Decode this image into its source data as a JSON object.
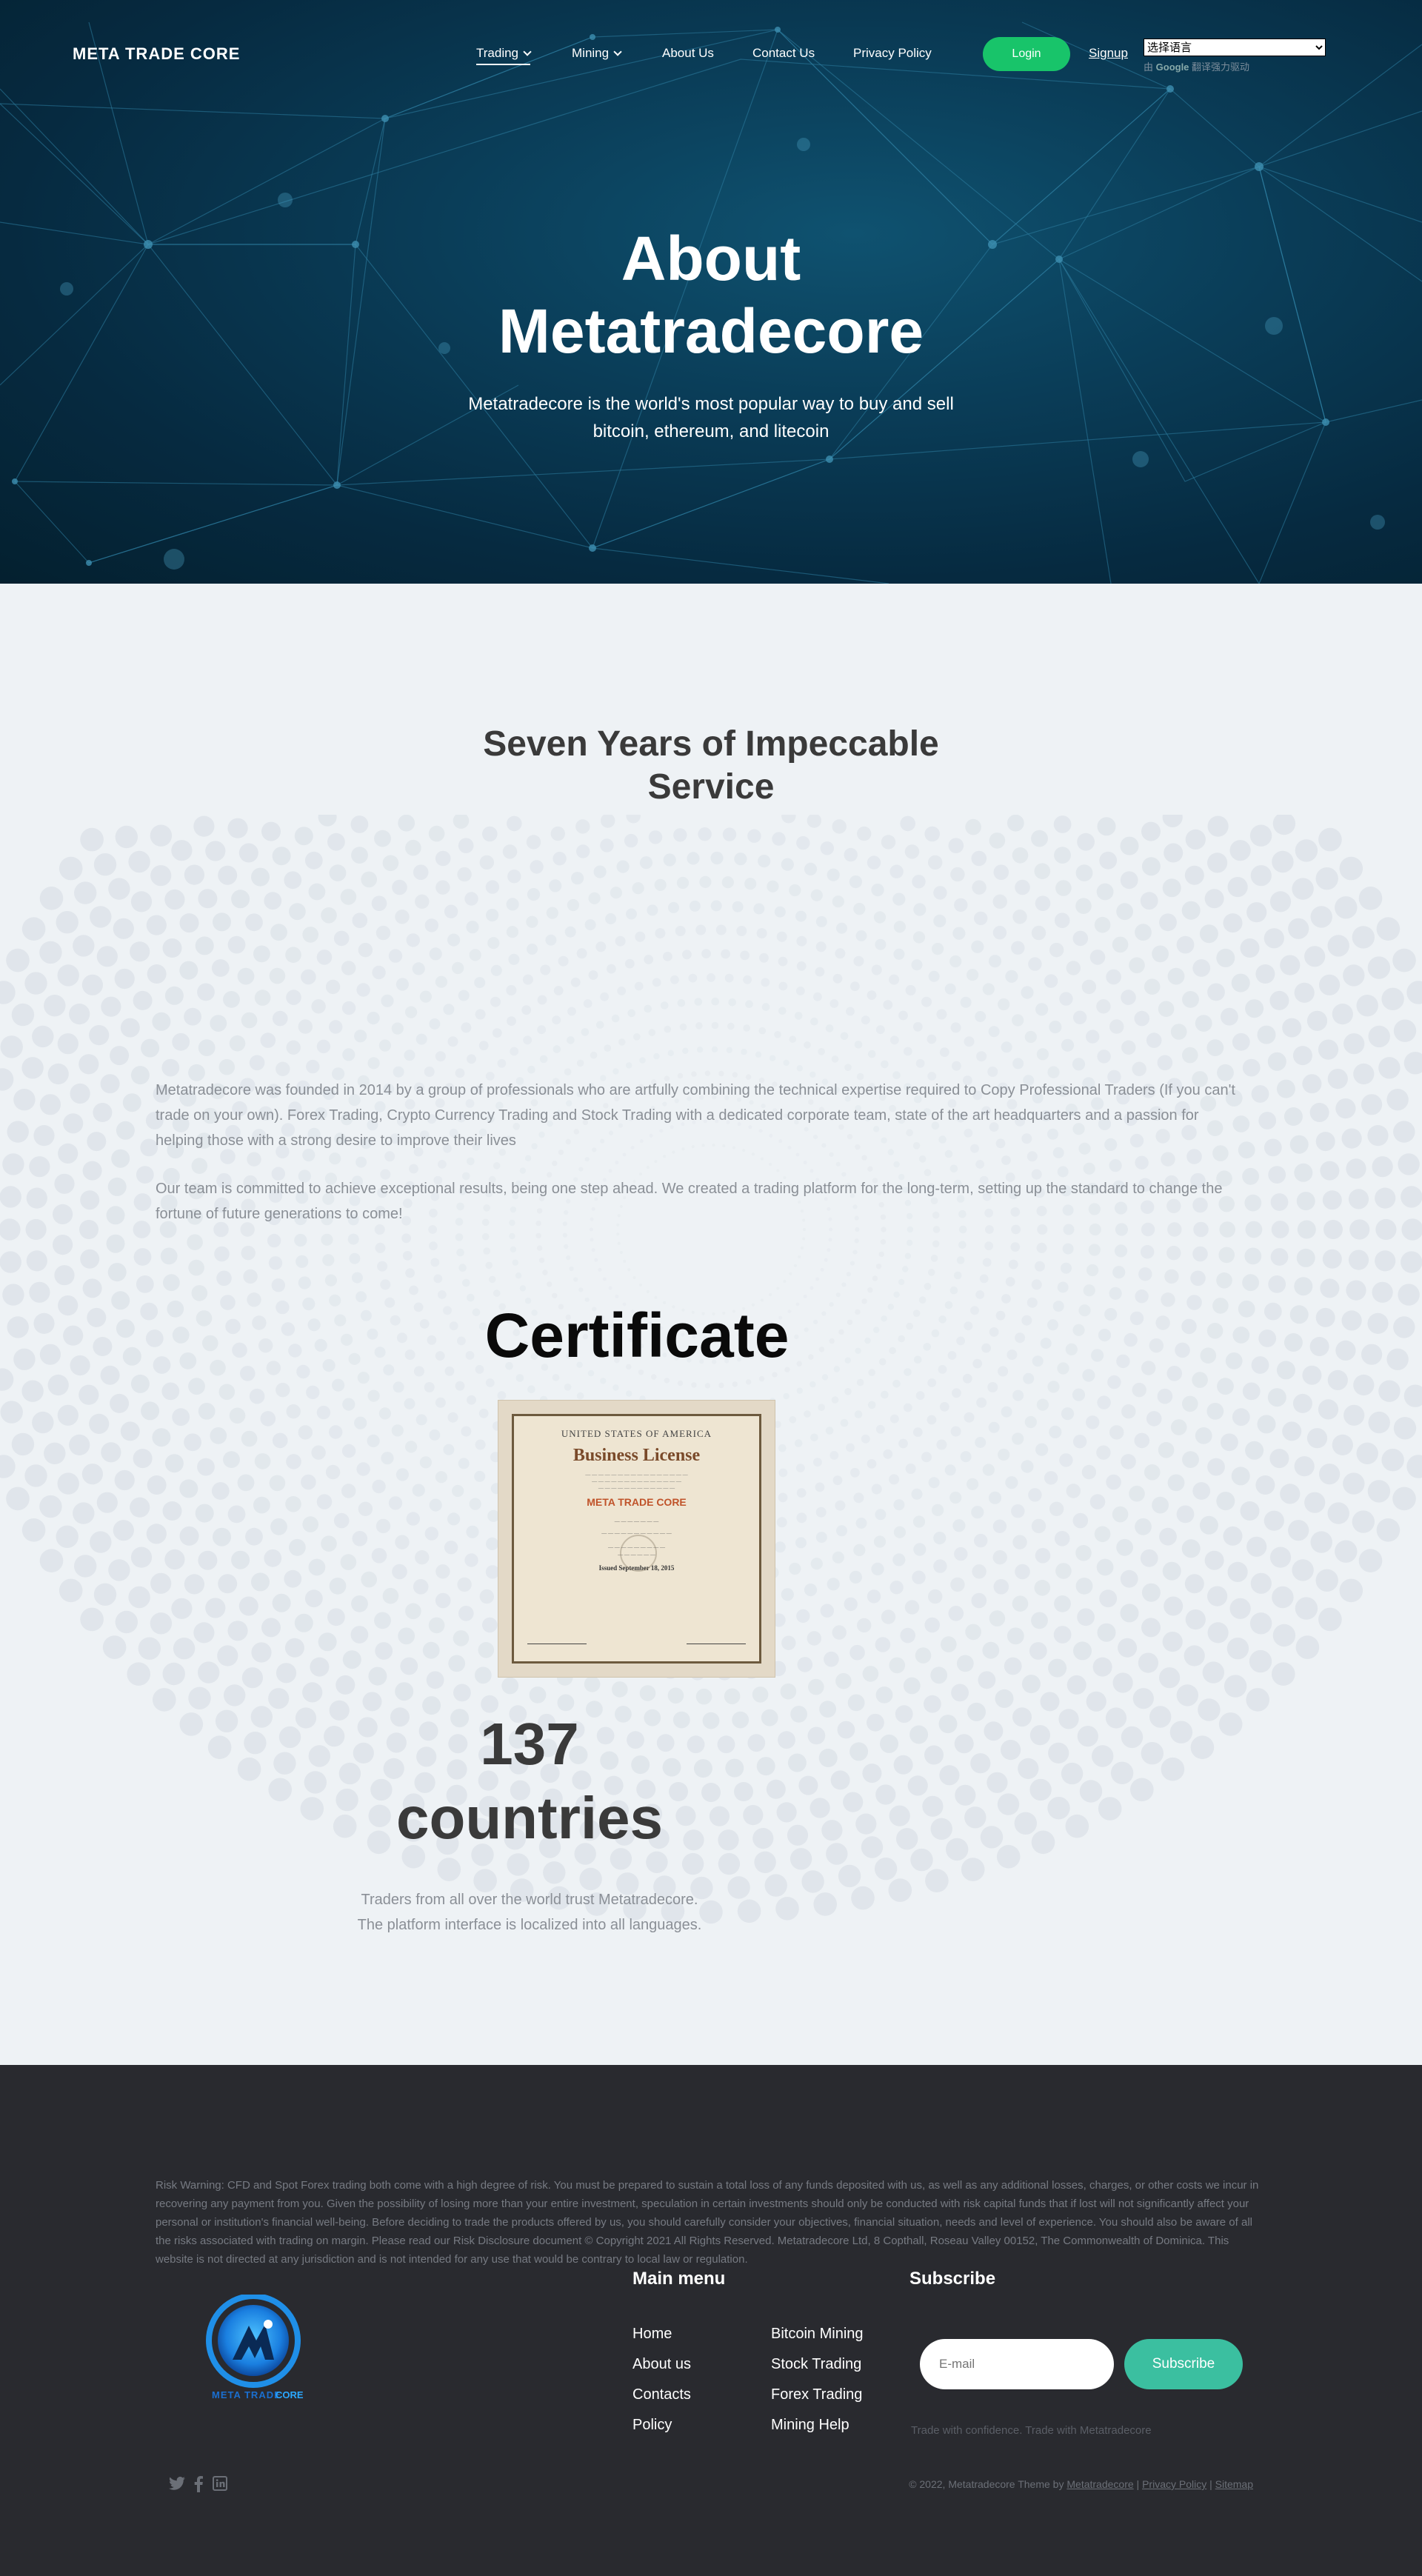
{
  "nav": {
    "brand": "META TRADE CORE",
    "items": [
      {
        "label": "Trading",
        "dropdown": true,
        "active": true
      },
      {
        "label": "Mining",
        "dropdown": true,
        "active": false
      },
      {
        "label": "About Us",
        "dropdown": false,
        "active": false
      },
      {
        "label": "Contact Us",
        "dropdown": false,
        "active": false
      },
      {
        "label": "Privacy Policy",
        "dropdown": false,
        "active": false
      }
    ],
    "login_label": "Login",
    "signup_label": "Signup",
    "language_select": "选择语言",
    "powered_prefix": "由",
    "powered_google": "Google",
    "powered_suffix": "翻译强力驱动"
  },
  "hero": {
    "title_line1": "About",
    "title_line2": "Metatradecore",
    "subtitle": "Metatradecore is the world's most popular way to buy and sell bitcoin, ethereum, and litecoin"
  },
  "about": {
    "title_line1": "Seven Years of Impeccable",
    "title_line2": "Service",
    "paragraph1": "Metatradecore was founded in 2014 by a group of professionals who are artfully combining the technical expertise required to Copy Professional Traders (If you can't trade on your own). Forex Trading, Crypto Currency Trading and Stock Trading with a dedicated corporate team, state of the art headquarters and a passion for helping those with a strong desire to improve their lives",
    "paragraph2": "Our team is committed to achieve exceptional results, being one step ahead. We created a trading platform for the long-term, setting up the standard to change the fortune of future generations to come!"
  },
  "certificate": {
    "title": "Certificate",
    "header": "UNITED STATES OF AMERICA",
    "license_title": "Business License",
    "company": "META TRADE CORE",
    "issued": "Issued September 18, 2015"
  },
  "stats": {
    "number": "137",
    "unit": "countries",
    "description": "Traders from all over the world trust Metatradecore. The platform interface is localized into all languages."
  },
  "footer": {
    "risk_warning": "Risk Warning: CFD and Spot Forex trading both come with a high degree of risk. You must be prepared to sustain a total loss of any funds deposited with us, as well as any additional losses, charges, or other costs we incur in recovering any payment from you. Given the possibility of losing more than your entire investment, speculation in certain investments should only be conducted with risk capital funds that if lost will not significantly affect your personal or institution's financial well-being. Before deciding to trade the products offered by us, you should carefully consider your objectives, financial situation, needs and level of experience. You should also be aware of all the risks associated with trading on margin. Please read our Risk Disclosure document © Copyright 2021 All Rights Reserved. Metatradecore Ltd, 8 Copthall, Roseau Valley 00152, The Commonwealth of Dominica. This website is not directed at any jurisdiction and is not intended for any use that would be contrary to local law or regulation.",
    "logo_text": "CORE",
    "main_menu_title": "Main menu",
    "menu_col1": [
      "Home",
      "About us",
      "Contacts",
      "Policy"
    ],
    "menu_col2": [
      "Bitcoin Mining",
      "Stock Trading",
      "Forex Trading",
      "Mining Help"
    ],
    "subscribe_title": "Subscribe",
    "email_placeholder": "E-mail",
    "subscribe_label": "Subscribe",
    "tagline": "Trade with confidence. Trade with Metatradecore",
    "copyright_prefix": "© 2022, Metatradecore Theme by",
    "copyright_link": "Metatradecore",
    "privacy_link": "Privacy Policy",
    "sitemap_link": "Sitemap",
    "social_icons": [
      "twitter-icon",
      "facebook-icon",
      "linkedin-icon"
    ]
  },
  "colors": {
    "hero_bg": "#0a3d58",
    "login_green": "#18c46a",
    "subscribe_teal": "#3bbfa0",
    "footer_bg": "#292a2f",
    "page_bg": "#eef2f5"
  }
}
